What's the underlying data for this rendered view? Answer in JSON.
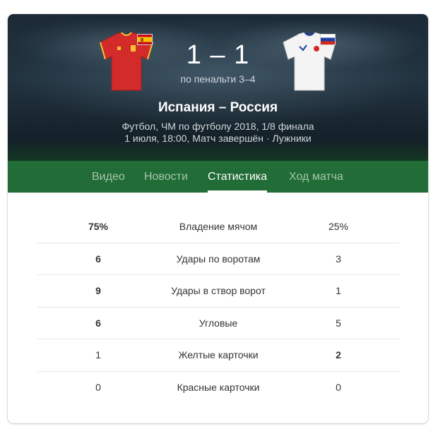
{
  "match": {
    "score": "1 – 1",
    "penalties": "по пенальти 3–4",
    "title": "Испания – Россия",
    "competition": "Футбол, ЧМ по футболу 2018, 1/8 финала",
    "details": "1 июля, 18:00, Матч завершён · Лужники"
  },
  "teams": {
    "home": {
      "shirt_icon": "red-jersey-icon",
      "flag_icon": "spain-flag-icon",
      "shirt_color": "#d32a2a"
    },
    "away": {
      "shirt_icon": "white-jersey-icon",
      "flag_icon": "russia-flag-icon",
      "shirt_color": "#f4f4f4"
    }
  },
  "tabs": [
    {
      "label": "Видео",
      "active": false
    },
    {
      "label": "Новости",
      "active": false
    },
    {
      "label": "Статистика",
      "active": true
    },
    {
      "label": "Ход матча",
      "active": false
    }
  ],
  "stats": [
    {
      "home": "75%",
      "label": "Владение мячом",
      "away": "25%",
      "home_bold": true,
      "away_bold": false
    },
    {
      "home": "6",
      "label": "Удары по воротам",
      "away": "3",
      "home_bold": true,
      "away_bold": false
    },
    {
      "home": "9",
      "label": "Удары в створ ворот",
      "away": "1",
      "home_bold": true,
      "away_bold": false
    },
    {
      "home": "6",
      "label": "Угловые",
      "away": "5",
      "home_bold": true,
      "away_bold": false
    },
    {
      "home": "1",
      "label": "Желтые карточки",
      "away": "2",
      "home_bold": false,
      "away_bold": true
    },
    {
      "home": "0",
      "label": "Красные карточки",
      "away": "0",
      "home_bold": false,
      "away_bold": false
    }
  ],
  "colors": {
    "tab_bar": "#226c37",
    "tab_inactive": "#a4c7ab",
    "tab_active": "#ffffff"
  }
}
